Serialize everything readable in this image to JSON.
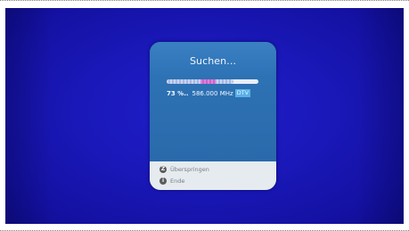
{
  "dialog": {
    "title": "Suchen...",
    "progress_fraction": 0.73,
    "percent_text": "73 %..",
    "frequency_text": "586.000 MHz",
    "signal_type": "DTV"
  },
  "footer": {
    "items": [
      {
        "key": "Z",
        "icon": "z-key-icon",
        "label": "Überspringen"
      },
      {
        "key": "i",
        "icon": "info-key-icon",
        "label": "Ende"
      }
    ]
  },
  "colors": {
    "screen_background": "#1a18b8",
    "dialog_body": "#2d72b4",
    "footer_background": "#e6ebef",
    "progress_accent": "#c964cd",
    "signal_badge": "#5ab0e4"
  }
}
